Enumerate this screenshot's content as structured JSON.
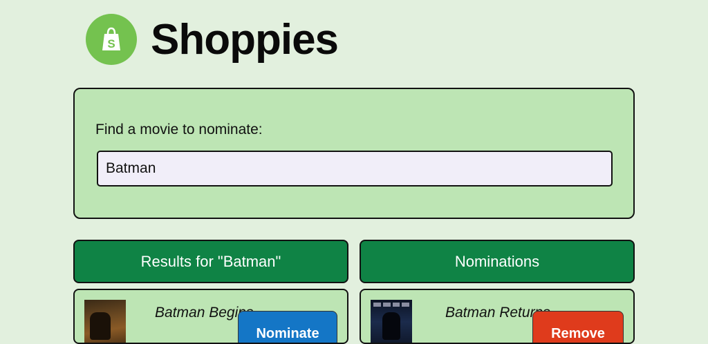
{
  "header": {
    "app_title": "Shoppies",
    "logo_icon": "shopping-bag-icon",
    "logo_color": "#74c24f"
  },
  "search": {
    "label": "Find a movie to nominate:",
    "value": "Batman"
  },
  "results": {
    "header": "Results for \"Batman\"",
    "items": [
      {
        "title": "Batman Begins",
        "action_label": "Nominate"
      }
    ]
  },
  "nominations": {
    "header": "Nominations",
    "items": [
      {
        "title": "Batman Returns",
        "action_label": "Remove"
      }
    ]
  },
  "colors": {
    "page_background": "#e2f0de",
    "card_background": "#bde5b4",
    "header_green": "#0f8345",
    "nominate_blue": "#1476c6",
    "remove_red": "#df3b1c"
  }
}
